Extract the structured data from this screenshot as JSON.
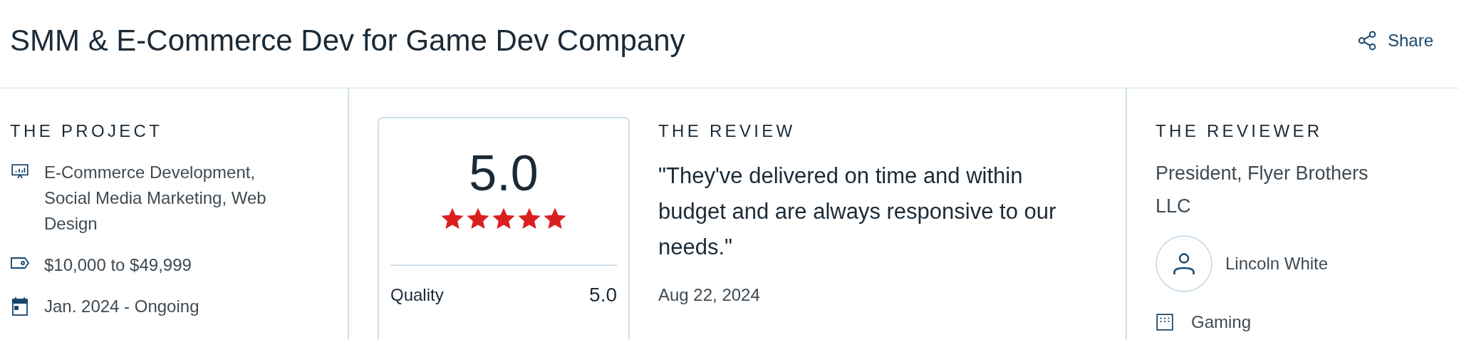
{
  "title": "SMM & E-Commerce Dev for Game Dev Company",
  "share": {
    "label": "Share"
  },
  "project": {
    "heading": "THE PROJECT",
    "items": [
      {
        "kind": "services",
        "text": "E-Commerce Development, Social Media Marketing, Web Design"
      },
      {
        "kind": "budget",
        "text": "$10,000 to $49,999"
      },
      {
        "kind": "dates",
        "text": "Jan. 2024 - Ongoing"
      }
    ]
  },
  "rating": {
    "score": "5.0",
    "stars": 5,
    "rows": [
      {
        "label": "Quality",
        "value": "5.0"
      }
    ]
  },
  "review": {
    "heading": "THE REVIEW",
    "quote": "\"They've delivered on time and within budget and are always responsive to our needs.\"",
    "date": "Aug 22, 2024"
  },
  "reviewer": {
    "heading": "THE REVIEWER",
    "position": "President, Flyer Brothers LLC",
    "name": "Lincoln White",
    "industry": "Gaming"
  }
}
